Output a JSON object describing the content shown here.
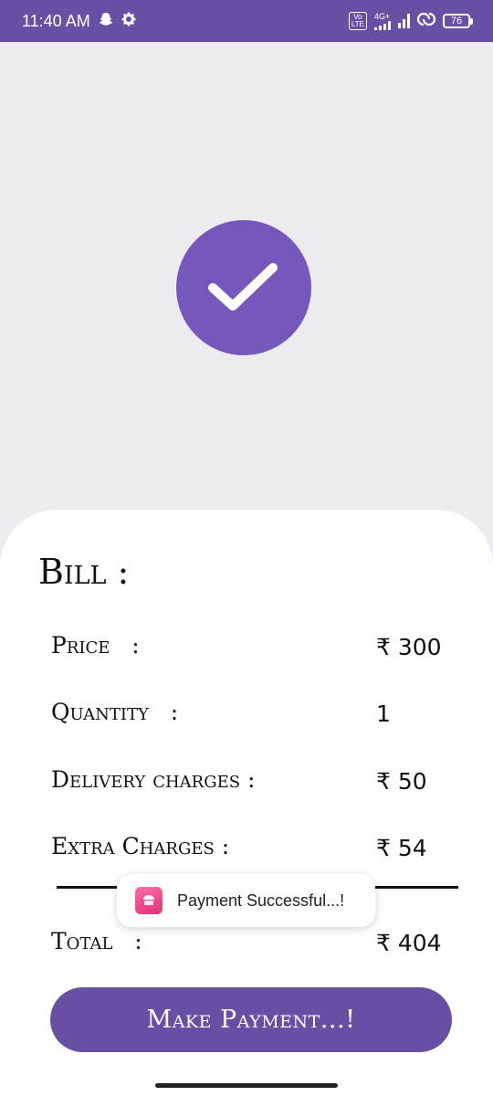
{
  "status_bar": {
    "time": "11:40 AM",
    "volte_top": "Vo",
    "volte_bottom": "LTE",
    "network": "4G+",
    "battery": "76",
    "icons": [
      "snapchat-icon",
      "gear-icon",
      "volte-icon",
      "signal-icon",
      "hotspot-icon",
      "battery-icon"
    ]
  },
  "success_icon": "check-icon",
  "bill": {
    "title": "Bill :",
    "rows": [
      {
        "label": "Price   :",
        "value": "₹ 300"
      },
      {
        "label": "Quantity   :",
        "value": "1"
      },
      {
        "label": "Delivery charges :",
        "value": "₹ 50"
      },
      {
        "label": "Extra Charges :",
        "value": "₹ 54"
      }
    ],
    "total": {
      "label": "Total   :",
      "value": "₹ 404"
    }
  },
  "toast": {
    "icon": "cakes-app-icon",
    "message": "Payment Successful...!"
  },
  "pay_button_label": "Make Payment...!",
  "colors": {
    "primary": "#6750a4",
    "check_circle": "#7658bc",
    "background": "#ececf0",
    "sheet": "#ffffff"
  }
}
